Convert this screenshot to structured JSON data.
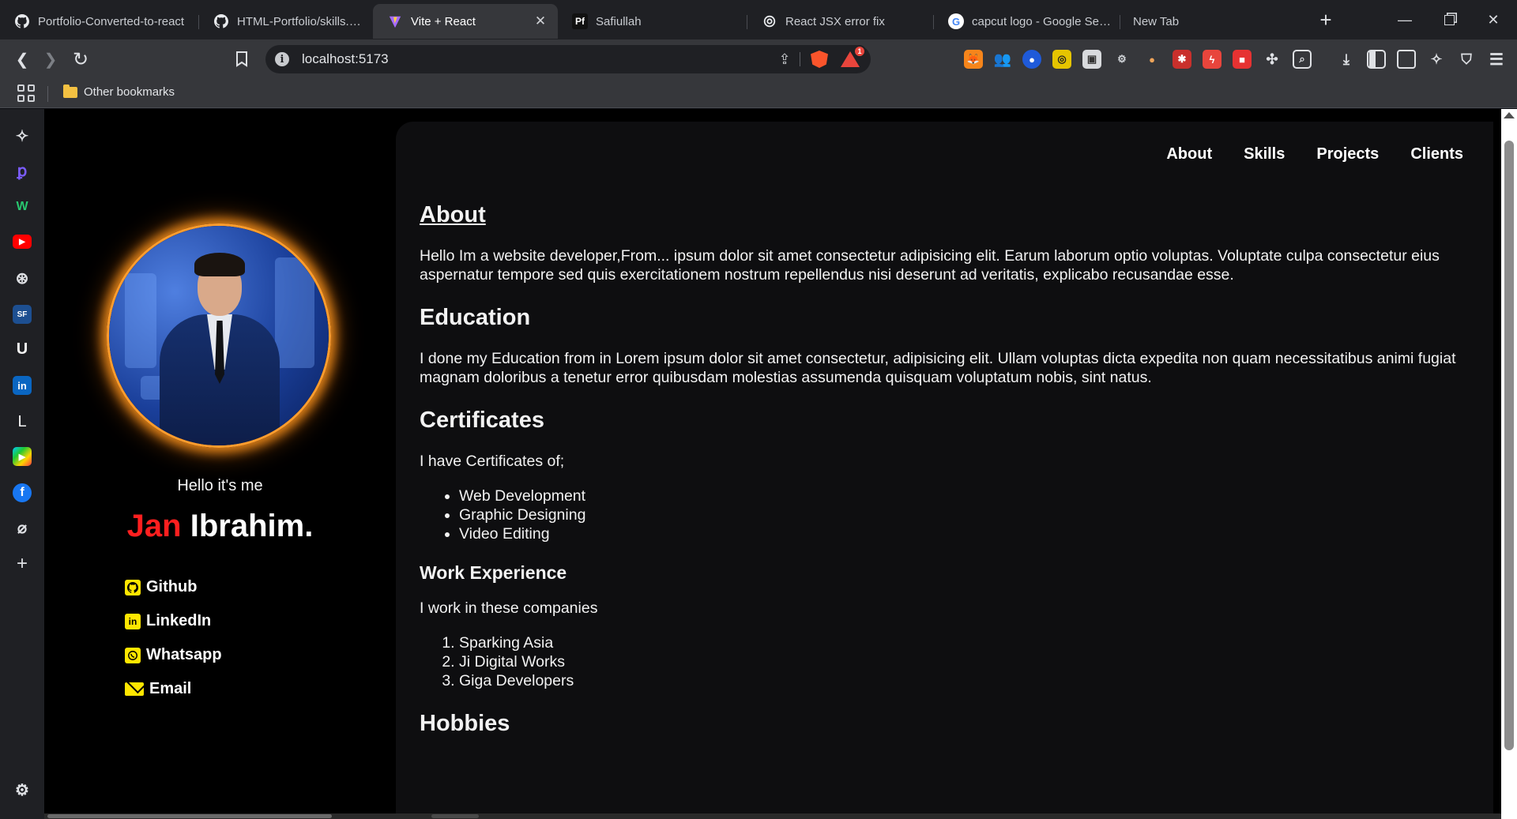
{
  "browser": {
    "tabs": [
      {
        "title": "Portfolio-Converted-to-react",
        "icon": "github-icon"
      },
      {
        "title": "HTML-Portfolio/skills.html",
        "icon": "github-icon"
      },
      {
        "title": "Vite + React",
        "icon": "vite-icon",
        "active": true
      },
      {
        "title": "Safiullah",
        "icon": "pf-icon",
        "icon_text": "Pf"
      },
      {
        "title": "React JSX error fix",
        "icon": "openai-icon"
      },
      {
        "title": "capcut logo - Google Search",
        "icon": "google-icon"
      },
      {
        "title": "New Tab",
        "icon": ""
      }
    ],
    "address": "localhost:5173",
    "rewards_badge": "1",
    "bookmark_folder": "Other bookmarks"
  },
  "profile": {
    "greeting": "Hello it's me",
    "first_name": "Jan",
    "last_name": "Ibrahim.",
    "links": [
      {
        "label": "Github",
        "icon": "github-icon"
      },
      {
        "label": "LinkedIn",
        "icon": "linkedin-icon"
      },
      {
        "label": "Whatsapp",
        "icon": "whatsapp-icon"
      },
      {
        "label": "Email",
        "icon": "email-icon"
      }
    ]
  },
  "nav": [
    "About",
    "Skills",
    "Projects",
    "Clients"
  ],
  "main": {
    "about_heading": "About",
    "about_text": "Hello Im a website developer,From... ipsum dolor sit amet consectetur adipisicing elit. Earum laborum optio voluptas. Voluptate culpa consectetur eius aspernatur tempore sed quis exercitationem nostrum repellendus nisi deserunt ad veritatis, explicabo recusandae esse.",
    "education_heading": "Education",
    "education_text": "I done my Education from in Lorem ipsum dolor sit amet consectetur, adipisicing elit. Ullam voluptas dicta expedita non quam necessitatibus animi fugiat magnam doloribus a tenetur error quibusdam molestias assumenda quisquam voluptatum nobis, sint natus.",
    "certificates_heading": "Certificates",
    "certificates_text": "I have Certificates of;",
    "certificates": [
      "Web Development",
      "Graphic Designing",
      "Video Editing"
    ],
    "work_heading": "Work Experience",
    "work_text": "I work in these companies",
    "companies": [
      "Sparking Asia",
      "Ji Digital Works",
      "Giga Developers"
    ],
    "hobbies_heading": "Hobbies"
  },
  "colors": {
    "accent_red": "#ff1f1f",
    "link_icon_yellow": "#ffe600",
    "photo_glow": "#ff9d2e",
    "content_bg": "#0e0e10"
  }
}
